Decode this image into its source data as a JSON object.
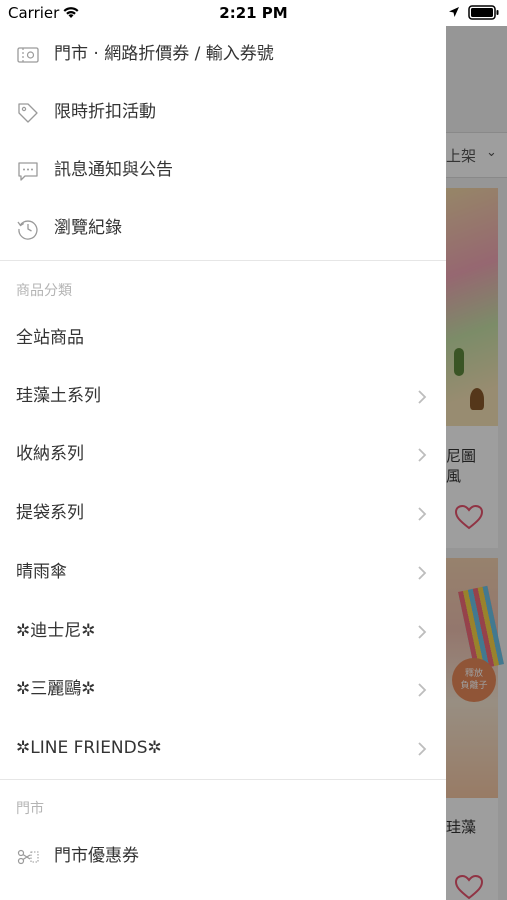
{
  "status_bar": {
    "carrier": "Carrier",
    "time": "2:21 PM"
  },
  "drawer": {
    "top_items": [
      {
        "label": "門市 · 網路折價券 / 輸入券號",
        "icon": "coupon-icon"
      },
      {
        "label": "限時折扣活動",
        "icon": "tag-icon"
      },
      {
        "label": "訊息通知與公告",
        "icon": "message-icon"
      },
      {
        "label": "瀏覽紀錄",
        "icon": "history-icon"
      }
    ],
    "category_section": {
      "title": "商品分類",
      "items": [
        {
          "label": "全站商品",
          "chevron": false
        },
        {
          "label": "珪藻土系列",
          "chevron": true
        },
        {
          "label": "收納系列",
          "chevron": true
        },
        {
          "label": "提袋系列",
          "chevron": true
        },
        {
          "label": "晴雨傘",
          "chevron": true
        },
        {
          "label": "✲迪士尼✲",
          "chevron": true
        },
        {
          "label": "✲三麗鷗✲",
          "chevron": true
        },
        {
          "label": "✲LINE FRIENDS✲",
          "chevron": true
        }
      ]
    },
    "store_section": {
      "title": "門市",
      "items": [
        {
          "label": "門市優惠券",
          "icon": "scissors-coupon-icon"
        }
      ]
    }
  },
  "background": {
    "sort_label": "上架",
    "card1_title": "尼圖\n風",
    "card2_title": "珪藻",
    "card2_badge": "釋放\n負離子"
  },
  "colors": {
    "accent": "#e8546f",
    "text": "#333333",
    "section_header": "#b4b4b4"
  }
}
